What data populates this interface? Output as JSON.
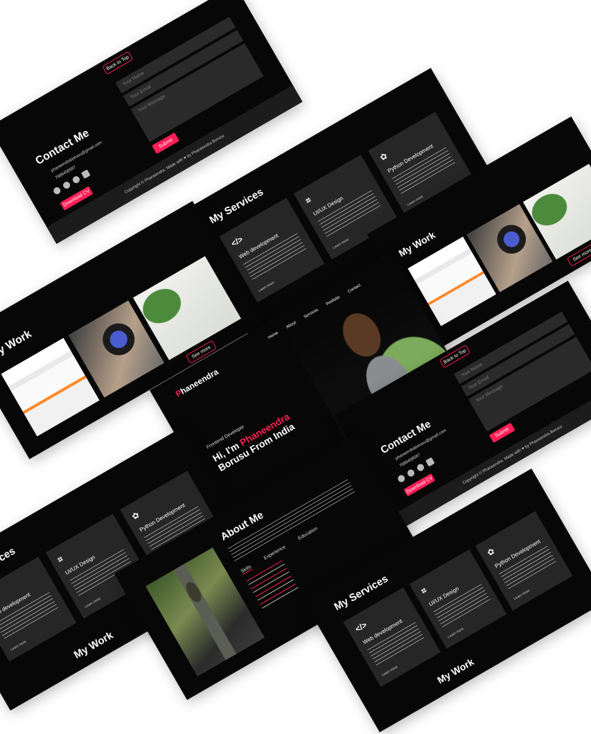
{
  "brand": {
    "initial": "P",
    "rest": "haneendra"
  },
  "nav": [
    "Home",
    "About",
    "Services",
    "Portfolio",
    "Contact"
  ],
  "hero": {
    "role": "Frontend Developer",
    "hi": "Hi, I'm ",
    "name": "Phaneendra",
    "line2": "Borusu From India"
  },
  "about": {
    "title": "About Me",
    "tabs": [
      "Skills",
      "Experience",
      "Education"
    ]
  },
  "services": {
    "title": "My Services",
    "items": [
      {
        "icon": "code-icon",
        "glyph": "</>",
        "name": "Web development",
        "more": "Learn more"
      },
      {
        "icon": "crop-icon",
        "glyph": "⌗",
        "name": "UI/UX Design",
        "more": "Learn more"
      },
      {
        "icon": "python-icon",
        "glyph": "✿",
        "name": "Python Development",
        "more": "Learn more"
      }
    ]
  },
  "work": {
    "title": "My Work",
    "more_button": "See more"
  },
  "contact": {
    "title": "Contact Me",
    "email": "phaneendraborusu@gmail.com",
    "phone": "7989458587",
    "download": "Download CV",
    "name_placeholder": "Your Name",
    "email_placeholder": "Your Email",
    "message_placeholder": "Your Message",
    "submit": "Submit",
    "back_to_top": "Back to Top",
    "copyright": "Copyright © Phaneendra. Made with ♥ by Phaneendra Borusu"
  },
  "colors": {
    "accent": "#ff1e56",
    "background": "#070707",
    "card": "#262626"
  }
}
